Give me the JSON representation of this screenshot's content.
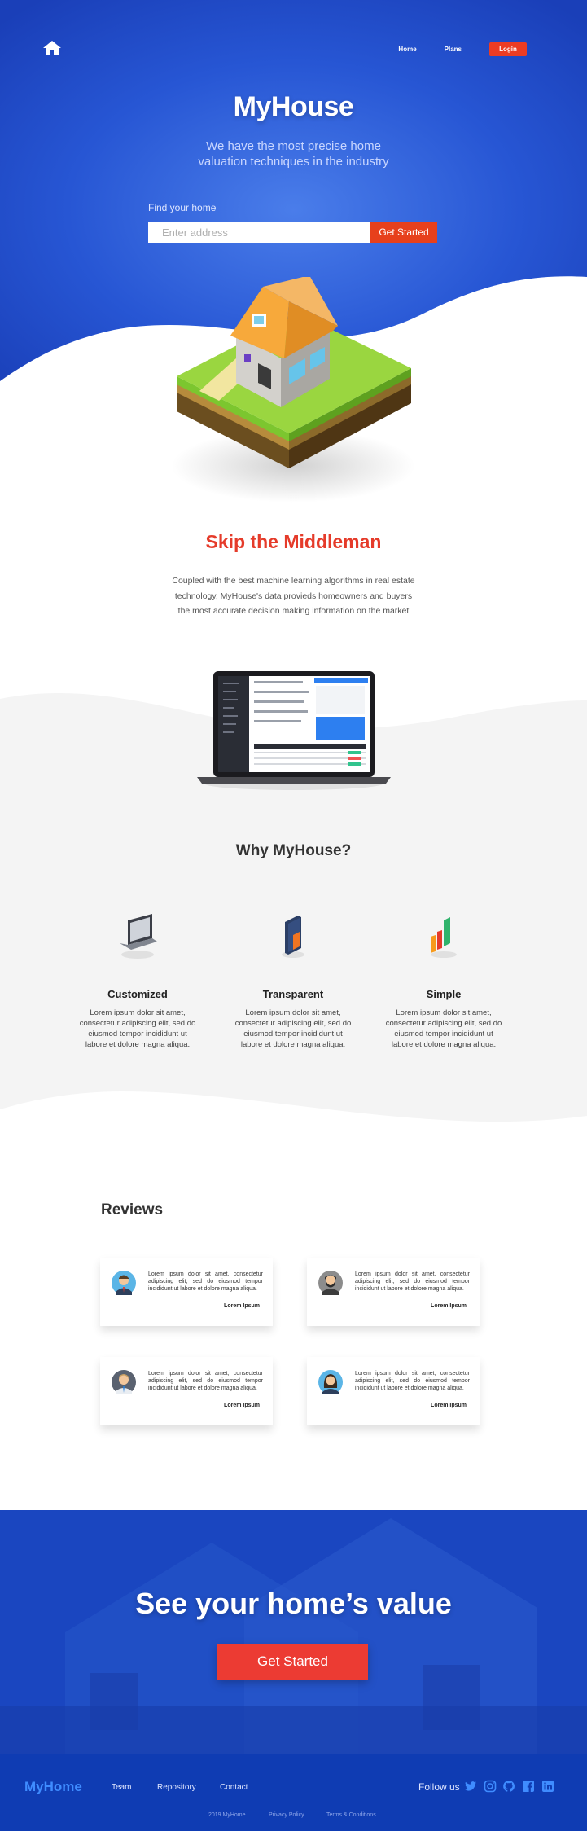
{
  "nav": {
    "home_icon": "house-icon",
    "links": [
      "Home",
      "Plans"
    ],
    "login_label": "Login"
  },
  "hero": {
    "title": "MyHouse",
    "subtitle_line1": "We have the most precise home",
    "subtitle_line2": "valuation techniques in the industry",
    "find_label": "Find your home",
    "search_placeholder": "Enter address",
    "search_button": "Get Started"
  },
  "skip": {
    "title": "Skip the Middleman",
    "text": "Coupled with the best machine learning algorithms in real estate technology, MyHouse's data provieds homeowners and buyers the most accurate decision making information on the market"
  },
  "why": {
    "title": "Why MyHouse?",
    "features": [
      {
        "title": "Customized",
        "text": "Lorem ipsum dolor sit amet, consectetur adipiscing elit, sed do eiusmod tempor incididunt ut labore et dolore magna aliqua.",
        "icon": "laptop-icon"
      },
      {
        "title": "Transparent",
        "text": "Lorem ipsum dolor sit amet, consectetur adipiscing elit, sed do eiusmod tempor incididunt ut labore et dolore magna aliqua.",
        "icon": "door-icon"
      },
      {
        "title": "Simple",
        "text": "Lorem ipsum dolor sit amet, consectetur adipiscing elit, sed do eiusmod tempor incididunt ut labore et dolore magna aliqua.",
        "icon": "bar-chart-icon"
      }
    ]
  },
  "reviews": {
    "title": "Reviews",
    "items": [
      {
        "text": "Lorem ipsum dolor sit amet, consectetur adipiscing elit, sed do eiusmod tempor incididunt ut labore et dolore magna aliqua.",
        "name": "Lorem Ipsum"
      },
      {
        "text": "Lorem ipsum dolor sit amet, consectetur adipiscing elit, sed do eiusmod tempor incididunt ut labore et dolore magna aliqua.",
        "name": "Lorem Ipsum"
      },
      {
        "text": "Lorem ipsum dolor sit amet, consectetur adipiscing elit, sed do eiusmod tempor incididunt ut labore et dolore magna aliqua.",
        "name": "Lorem Ipsum"
      },
      {
        "text": "Lorem ipsum dolor sit amet, consectetur adipiscing elit, sed do eiusmod tempor incididunt ut labore et dolore magna aliqua.",
        "name": "Lorem Ipsum"
      }
    ]
  },
  "cta": {
    "title": "See your home’s value",
    "button": "Get Started"
  },
  "footer": {
    "logo": "MyHome",
    "links": [
      "Team",
      "Repository",
      "Contact"
    ],
    "follow": "Follow us",
    "social_icons": [
      "twitter-icon",
      "instagram-icon",
      "github-icon",
      "facebook-icon",
      "linkedin-icon"
    ],
    "copyright": "2019 MyHome",
    "privacy": "Privacy Policy",
    "terms": "Terms & Conditions"
  },
  "colors": {
    "primary_blue": "#1c48c3",
    "accent_red": "#ec3c23",
    "footer_blue": "#0f3cb3",
    "grey_bg": "#f4f4f4"
  }
}
